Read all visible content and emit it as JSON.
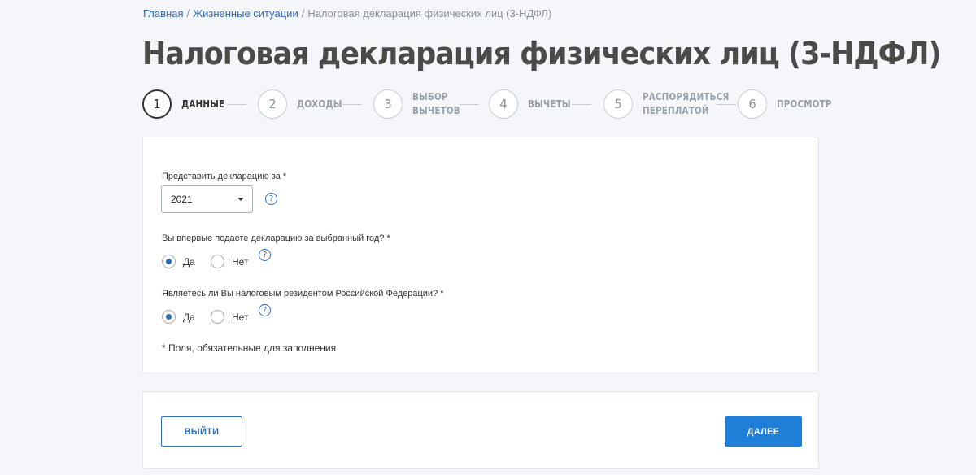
{
  "breadcrumb": {
    "home": "Главная",
    "situations": "Жизненные ситуации",
    "current": "Налоговая декларация физических лиц (3-НДФЛ)",
    "separator": "/"
  },
  "title": "Налоговая декларация физических лиц (3-НДФЛ)",
  "steps": [
    {
      "number": "1",
      "label_line1": "Данные",
      "label_line2": ""
    },
    {
      "number": "2",
      "label_line1": "Доходы",
      "label_line2": ""
    },
    {
      "number": "3",
      "label_line1": "Выбор",
      "label_line2": "вычетов"
    },
    {
      "number": "4",
      "label_line1": "Вычеты",
      "label_line2": ""
    },
    {
      "number": "5",
      "label_line1": "Распорядиться",
      "label_line2": "переплатой"
    },
    {
      "number": "6",
      "label_line1": "Просмотр",
      "label_line2": ""
    }
  ],
  "active_step": 1,
  "form": {
    "year_label": "Представить декларацию за *",
    "year_value": "2021",
    "first_time_label": "Вы впервые подаете декларацию за выбранный год? *",
    "resident_label": "Являетесь ли Вы налоговым резидентом Российской Федерации? *",
    "yes": "Да",
    "no": "Нет",
    "first_time_selected": "Да",
    "resident_selected": "Да",
    "help_glyph": "?",
    "required_note": "* Поля, обязательные для заполнения"
  },
  "actions": {
    "exit_label": "ВЫЙТИ",
    "next_label": "ДАЛЕЕ"
  },
  "colors": {
    "accent": "#1f7fd8",
    "link": "#2f6db5",
    "background": "#f4f6f9"
  }
}
